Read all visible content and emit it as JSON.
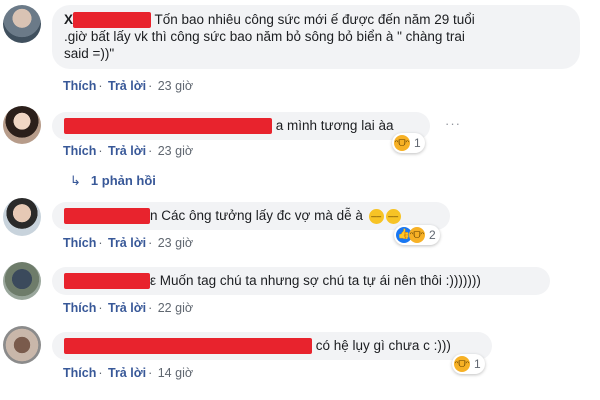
{
  "comments": [
    {
      "text": "Tốn bao nhiêu công sức mới ế được đến năm 29 tuổi .giờ bất lấy vk thì công sức bao năm bỏ sông bỏ biển à \" chàng trai said =))\"",
      "line1": "Tốn bao nhiêu công sức mới ế được đến năm 29 tuổi",
      "line2": ".giờ bất lấy vk thì công sức bao năm bỏ sông bỏ biển à \" chàng trai",
      "line3": "said =))\"",
      "name_prefix": "X",
      "like": "Thích",
      "reply": "Trả lời",
      "time": "23 giờ"
    },
    {
      "text": "a mình tương lai àa",
      "like": "Thích",
      "reply": "Trả lời",
      "time": "23 giờ",
      "reaction_count": "1",
      "reaction_icon": "haha-emoji-icon"
    },
    {
      "text": "Các ông tưởng lấy đc vợ mà dễ à",
      "name_suffix": "n",
      "like": "Thích",
      "reply": "Trả lời",
      "time": "23 giờ",
      "reaction_count": "2",
      "reaction_icon": "like-haha-icon"
    },
    {
      "text": "Muốn tag chú ta nhưng sợ chú ta tự ái nên thôi :)))))))",
      "name_suffix": "ε",
      "like": "Thích",
      "reply": "Trả lời",
      "time": "22 giờ"
    },
    {
      "text": "có hệ lụy gì chưa c :)))",
      "like": "Thích",
      "reply": "Trả lời",
      "time": "14 giờ",
      "reaction_count": "1",
      "reaction_icon": "haha-emoji-icon"
    }
  ],
  "replies_link": "1 phản hồi",
  "colors": {
    "link": "#385898",
    "redaction": "#e8232d",
    "bubble": "#f2f3f5"
  }
}
